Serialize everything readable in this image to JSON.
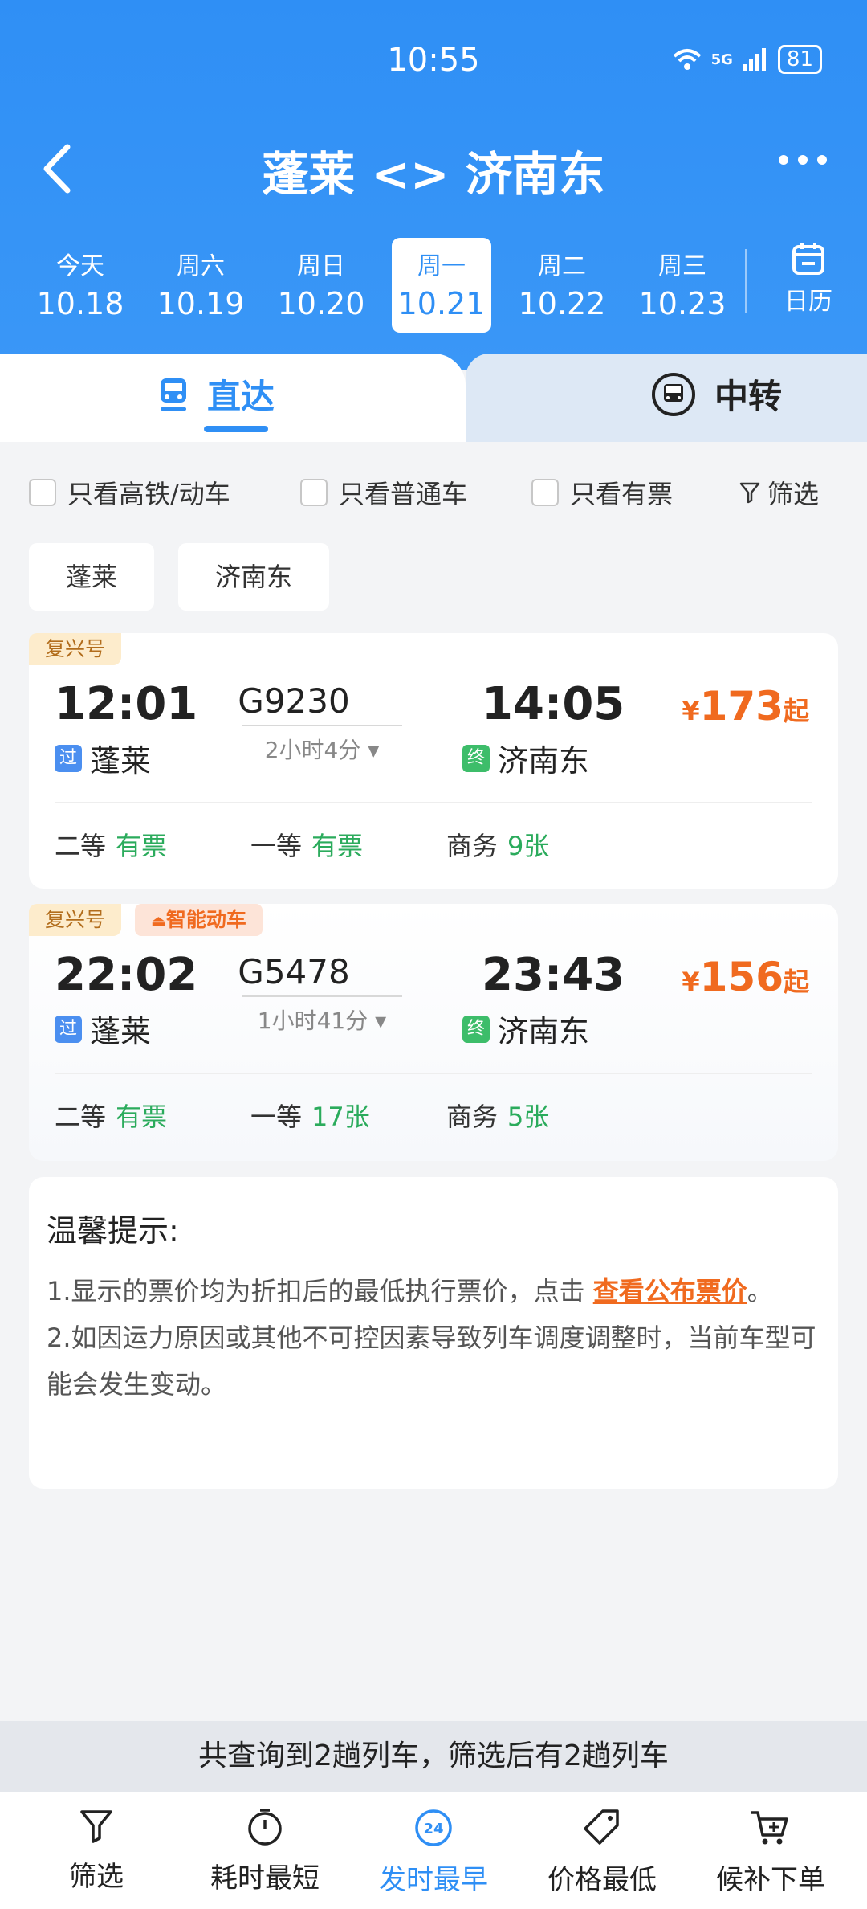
{
  "status_bar": {
    "time": "10:55",
    "signal": "5G",
    "battery": "81"
  },
  "header": {
    "title": "蓬莱 <> 济南东"
  },
  "dates": [
    {
      "weekday": "今天",
      "date": "10.18"
    },
    {
      "weekday": "周六",
      "date": "10.19"
    },
    {
      "weekday": "周日",
      "date": "10.20"
    },
    {
      "weekday": "周一",
      "date": "10.21"
    },
    {
      "weekday": "周二",
      "date": "10.22"
    },
    {
      "weekday": "周三",
      "date": "10.23"
    }
  ],
  "calendar_label": "日历",
  "tabs": {
    "direct": "直达",
    "transfer": "中转"
  },
  "filters": {
    "high_speed": "只看高铁/动车",
    "normal": "只看普通车",
    "available": "只看有票",
    "screen": "筛选"
  },
  "stations": {
    "from": "蓬莱",
    "to": "济南东"
  },
  "trains": [
    {
      "tags": [
        "复兴号"
      ],
      "dep_time": "12:01",
      "arr_time": "14:05",
      "train_no": "G9230",
      "duration": "2小时4分",
      "from_badge": "过",
      "from": "蓬莱",
      "to_badge": "终",
      "to": "济南东",
      "price_symbol": "¥",
      "price": "173",
      "price_suffix": "起",
      "seats": [
        {
          "class": "二等",
          "status": "有票"
        },
        {
          "class": "一等",
          "status": "有票"
        },
        {
          "class": "商务",
          "status": "9张"
        }
      ]
    },
    {
      "tags": [
        "复兴号",
        "智能动车"
      ],
      "dep_time": "22:02",
      "arr_time": "23:43",
      "train_no": "G5478",
      "duration": "1小时41分",
      "from_badge": "过",
      "from": "蓬莱",
      "to_badge": "终",
      "to": "济南东",
      "price_symbol": "¥",
      "price": "156",
      "price_suffix": "起",
      "seats": [
        {
          "class": "二等",
          "status": "有票"
        },
        {
          "class": "一等",
          "status": "17张"
        },
        {
          "class": "商务",
          "status": "5张"
        }
      ]
    }
  ],
  "tips": {
    "title": "温馨提示:",
    "line1_pre": "1.显示的票价均为折扣后的最低执行票价，点击 ",
    "line1_link": "查看公布票价",
    "line1_post": "。",
    "line2": "2.如因运力原因或其他不可控因素导致列车调度调整时，当前车型可能会发生变动。"
  },
  "summary": "共查询到2趟列车，筛选后有2趟列车",
  "bottom_nav": [
    {
      "label": "筛选",
      "icon": "filter-icon"
    },
    {
      "label": "耗时最短",
      "icon": "timer-icon"
    },
    {
      "label": "发时最早",
      "icon": "clock-24-icon",
      "badge": "24"
    },
    {
      "label": "价格最低",
      "icon": "price-tag-icon"
    },
    {
      "label": "候补下单",
      "icon": "cart-add-icon"
    }
  ],
  "colors": {
    "primary": "#2f8ff5",
    "price": "#f06a1f",
    "available": "#2bab5c"
  }
}
